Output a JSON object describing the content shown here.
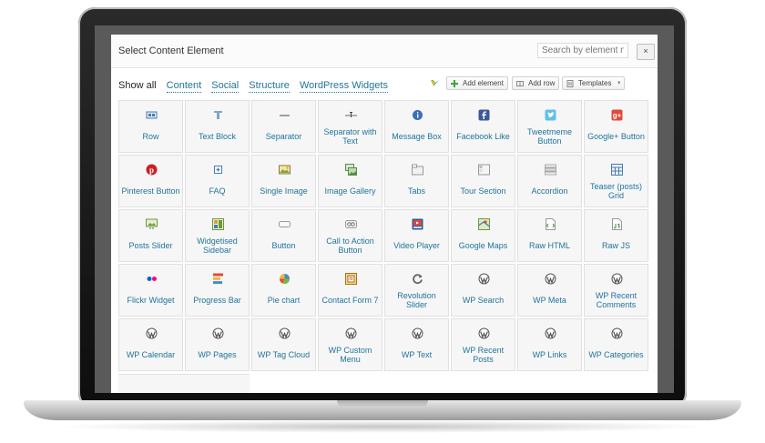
{
  "modal": {
    "title": "Select Content Element",
    "search_placeholder": "Search by element na",
    "close_label": "×"
  },
  "filters": [
    "Show all",
    "Content",
    "Social",
    "Structure",
    "WordPress Widgets"
  ],
  "toolbar": {
    "add_element": "Add element",
    "add_row": "Add row",
    "templates": "Templates"
  },
  "elements": [
    {
      "label": "Row",
      "icon": "row-icon"
    },
    {
      "label": "Text Block",
      "icon": "text-block-icon"
    },
    {
      "label": "Separator",
      "icon": "separator-icon"
    },
    {
      "label": "Separator with Text",
      "icon": "separator-text-icon"
    },
    {
      "label": "Message Box",
      "icon": "info-icon"
    },
    {
      "label": "Facebook Like",
      "icon": "facebook-icon"
    },
    {
      "label": "Tweetmeme Button",
      "icon": "twitter-icon"
    },
    {
      "label": "Google+ Button",
      "icon": "google-plus-icon"
    },
    {
      "label": "Pinterest Button",
      "icon": "pinterest-icon"
    },
    {
      "label": "FAQ",
      "icon": "faq-icon"
    },
    {
      "label": "Single Image",
      "icon": "image-icon"
    },
    {
      "label": "Image Gallery",
      "icon": "gallery-icon"
    },
    {
      "label": "Tabs",
      "icon": "tabs-icon"
    },
    {
      "label": "Tour Section",
      "icon": "tour-icon"
    },
    {
      "label": "Accordion",
      "icon": "accordion-icon"
    },
    {
      "label": "Teaser (posts) Grid",
      "icon": "grid-icon"
    },
    {
      "label": "Posts Slider",
      "icon": "slider-icon"
    },
    {
      "label": "Widgetised Sidebar",
      "icon": "sidebar-icon"
    },
    {
      "label": "Button",
      "icon": "button-icon"
    },
    {
      "label": "Call to Action Button",
      "icon": "cta-icon"
    },
    {
      "label": "Video Player",
      "icon": "video-icon"
    },
    {
      "label": "Google Maps",
      "icon": "map-icon"
    },
    {
      "label": "Raw HTML",
      "icon": "raw-html-icon"
    },
    {
      "label": "Raw JS",
      "icon": "raw-js-icon"
    },
    {
      "label": "Flickr Widget",
      "icon": "flickr-icon"
    },
    {
      "label": "Progress Bar",
      "icon": "progress-bar-icon"
    },
    {
      "label": "Pie chart",
      "icon": "pie-chart-icon"
    },
    {
      "label": "Contact Form 7",
      "icon": "contact-form-icon"
    },
    {
      "label": "Revolution Slider",
      "icon": "revolution-icon"
    },
    {
      "label": "WP Search",
      "icon": "wordpress-icon"
    },
    {
      "label": "WP Meta",
      "icon": "wordpress-icon"
    },
    {
      "label": "WP Recent Comments",
      "icon": "wordpress-icon"
    },
    {
      "label": "WP Calendar",
      "icon": "wordpress-icon"
    },
    {
      "label": "WP Pages",
      "icon": "wordpress-icon"
    },
    {
      "label": "WP Tag Cloud",
      "icon": "wordpress-icon"
    },
    {
      "label": "WP Custom Menu",
      "icon": "wordpress-icon"
    },
    {
      "label": "WP Text",
      "icon": "wordpress-icon"
    },
    {
      "label": "WP Recent Posts",
      "icon": "wordpress-icon"
    },
    {
      "label": "WP Links",
      "icon": "wordpress-icon"
    },
    {
      "label": "WP Categories",
      "icon": "wordpress-icon"
    }
  ],
  "colors": {
    "link": "#21759b",
    "cell_bg": "#f6f6f6",
    "cell_border": "#e0e0e0"
  }
}
